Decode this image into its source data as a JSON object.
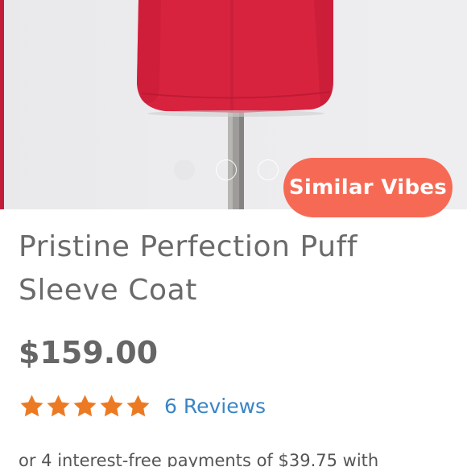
{
  "carousel": {
    "image_icon": "product-photo-red-coat-on-mannequin",
    "slide_count": 3,
    "active_slide": 1
  },
  "similar_vibes_label": "Similar Vibes",
  "product": {
    "title": "Pristine Perfection Puff Sleeve Coat",
    "price": "$159.00",
    "rating": 5,
    "rating_max": 5,
    "reviews_link": "6 Reviews",
    "installments_text": "or 4 interest-free payments of $39.75 with"
  },
  "colors": {
    "accent_button": "#f66a55",
    "star": "#ec7a23",
    "link": "#3a85c6",
    "coat": "#d8233f"
  }
}
